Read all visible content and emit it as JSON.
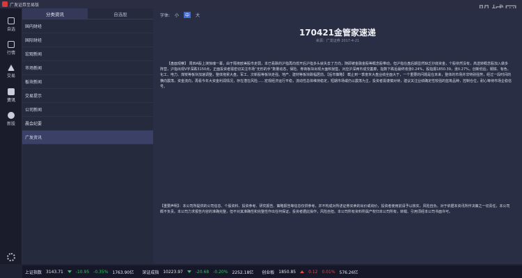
{
  "window": {
    "title": "广发证券至易版",
    "watermark": "股城网"
  },
  "sidebar": {
    "items": [
      {
        "label": "自选",
        "icon": "star-icon"
      },
      {
        "label": "行情",
        "icon": "chart-icon"
      },
      {
        "label": "交易",
        "icon": "trade-icon"
      },
      {
        "label": "资讯",
        "icon": "news-icon"
      },
      {
        "label": "新股",
        "icon": "ipo-icon"
      }
    ]
  },
  "tabs": [
    "分类资讯",
    "自选股"
  ],
  "categories": [
    "国内财经",
    "国际财经",
    "宏观新闻",
    "市场新闻",
    "板块新闻",
    "交易提示",
    "公司新闻",
    "晨会纪要",
    "广发资讯"
  ],
  "fontbar": {
    "label": "字体:",
    "small": "小",
    "medium": "中",
    "large": "大"
  },
  "article": {
    "title": "170421金管家速递",
    "meta": "来源：广发证券 2017-4-21",
    "body": "【盘面观察】 周四A股上演惊魂一幕，由于隔夜欧美股市走弱，本已看跌的沪指再向低开后沪指多头就失去了方向，随即被金融金股等概念股带动，但沪指在盘后期显然缺乏抄底资金，个股依然没有，高送转概念股加入做多阵营，沪指出现V字深跌3150点，正面投资者需密切关注市场“无形的手”数量动态，保险、券商板块出现大面积抛售，对应沪深两市成交萎靡，指数下跌后最终收涨0.24%，股指报1850.39，涨0.27%，创新低后，钢铁、有色、化工、电力、煤炭等板块加速调整，整体拖累大盘，军工、次新股等板块走强。地产、建材等板块跌幅居前。【后市策略】 截止到一季度末大盘业绩全面大于，一个重要的问题是在未来，整体的市场并非特别强势，经过一段时间的横向震荡，资金流向，再看今年大资金利润情况，存在潜在风险……宏观经济运行平稳，流动性总体维持稳定，短期市场或仍以震荡为主，投资者需谨慎对待，建议关注业绩确定性较强的蓝筹品种，控制仓位，耐心等待市场企稳信号。",
    "disclaimer": "【重要声明】：本公司所提供的公司信息、个股资料、投资参考、研究报告、策略报告等信息仅供参考，并不构成对所述证券买卖的出价或询价，投资者使用前请予以核实，风险自负。对于依据本资讯所作决策之一切责任，本公司概不负责。本公司力求报告内容的准确完整，但不对其准确性和完整性作出任何保证。投资者据此操作，风险自担。本公司所有资料所属产权归本公司所有，转载、引用须经本公司书面许可。"
  },
  "ticker": [
    {
      "name": "上证指数",
      "value": "3143.71",
      "change": "-10.95",
      "pct": "-0.35%",
      "volume": "1763.90亿",
      "dir": "down"
    },
    {
      "name": "深证成指",
      "value": "10223.97",
      "change": "-20.68",
      "pct": "-0.20%",
      "volume": "2252.18亿",
      "dir": "down"
    },
    {
      "name": "创业板",
      "value": "1850.85",
      "change": "0.12",
      "pct": "0.01%",
      "volume": "576.26亿",
      "dir": "up"
    }
  ],
  "colors": {
    "background": "#1f2233",
    "accent": "#3e6bd6",
    "down": "#33c25d",
    "up": "#e04848"
  }
}
